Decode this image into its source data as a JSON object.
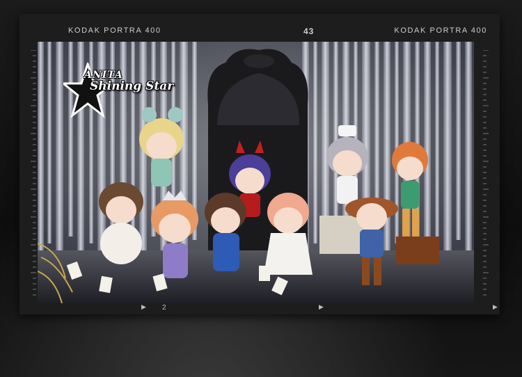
{
  "film_frame": {
    "edge_left": "KODAK PORTRA 400",
    "frame_number": "43",
    "edge_right": "KODAK PORTRA 400",
    "bottom_mark": "2"
  },
  "logo": {
    "line1": "ANITA",
    "line2": "Shining Star"
  },
  "photo": {
    "subject": "collectible figure set",
    "colors": {
      "backdrop_tinsel": "#c9ccd6",
      "throne": "#1a1a1d",
      "film_border": "#1d1d1d",
      "edge_text": "#cfcfcf"
    }
  }
}
